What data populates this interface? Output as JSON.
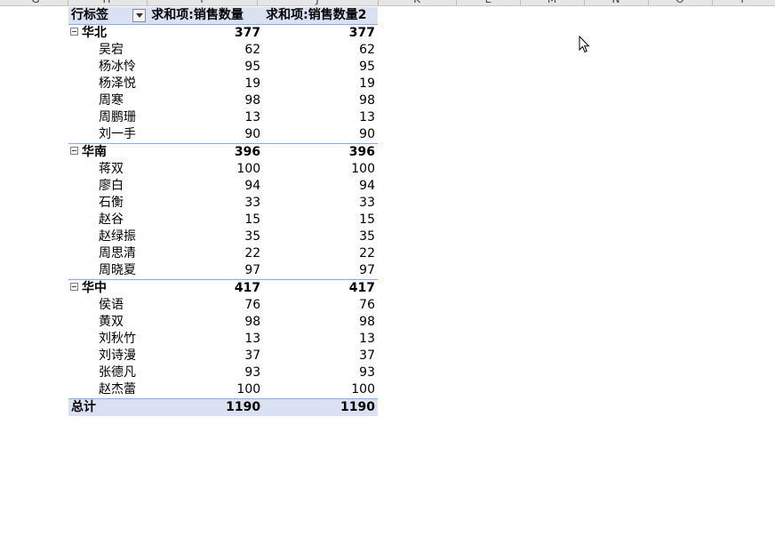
{
  "column_headers": [
    "G",
    "H",
    "I",
    "J",
    "K",
    "L",
    "M",
    "N",
    "O",
    "P"
  ],
  "pivot": {
    "header": {
      "row_label": "行标签",
      "col1": "求和项:销售数量",
      "col2": "求和项:销售数量2"
    },
    "groups": [
      {
        "name": "华北",
        "v1": "377",
        "v2": "377",
        "items": [
          {
            "name": "吴宕",
            "v1": "62",
            "v2": "62"
          },
          {
            "name": "杨冰怜",
            "v1": "95",
            "v2": "95"
          },
          {
            "name": "杨泽悦",
            "v1": "19",
            "v2": "19"
          },
          {
            "name": "周寒",
            "v1": "98",
            "v2": "98"
          },
          {
            "name": "周鹏珊",
            "v1": "13",
            "v2": "13"
          },
          {
            "name": "刘一手",
            "v1": "90",
            "v2": "90"
          }
        ]
      },
      {
        "name": "华南",
        "v1": "396",
        "v2": "396",
        "items": [
          {
            "name": "蒋双",
            "v1": "100",
            "v2": "100"
          },
          {
            "name": "廖白",
            "v1": "94",
            "v2": "94"
          },
          {
            "name": "石衡",
            "v1": "33",
            "v2": "33"
          },
          {
            "name": "赵谷",
            "v1": "15",
            "v2": "15"
          },
          {
            "name": "赵绿振",
            "v1": "35",
            "v2": "35"
          },
          {
            "name": "周思清",
            "v1": "22",
            "v2": "22"
          },
          {
            "name": "周晓夏",
            "v1": "97",
            "v2": "97"
          }
        ]
      },
      {
        "name": "华中",
        "v1": "417",
        "v2": "417",
        "items": [
          {
            "name": "侯语",
            "v1": "76",
            "v2": "76"
          },
          {
            "name": "黄双",
            "v1": "98",
            "v2": "98"
          },
          {
            "name": "刘秋竹",
            "v1": "13",
            "v2": "13"
          },
          {
            "name": "刘诗漫",
            "v1": "37",
            "v2": "37"
          },
          {
            "name": "张德凡",
            "v1": "93",
            "v2": "93"
          },
          {
            "name": "赵杰蕾",
            "v1": "100",
            "v2": "100"
          }
        ]
      }
    ],
    "total": {
      "label": "总计",
      "v1": "1190",
      "v2": "1190"
    }
  },
  "icons": {
    "collapse": "collapse-minus-icon",
    "filter": "filter-dropdown-icon",
    "cursor": "mouse-pointer-icon"
  }
}
